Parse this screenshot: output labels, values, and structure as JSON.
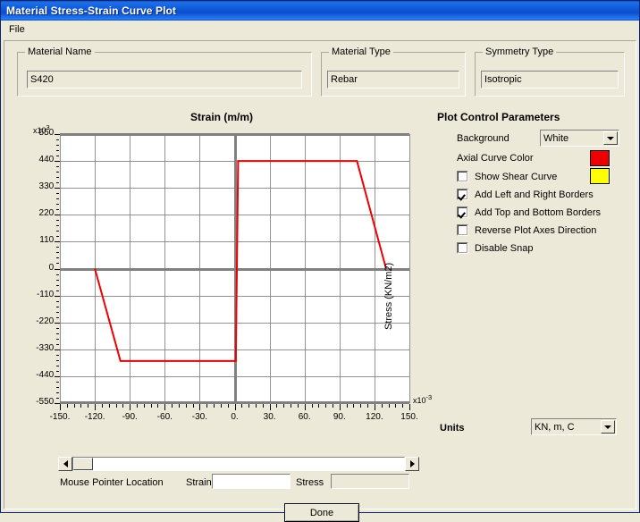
{
  "window": {
    "title": "Material Stress-Strain Curve Plot",
    "menu": [
      "File"
    ]
  },
  "material_name": {
    "caption": "Material Name",
    "value": "S420"
  },
  "material_type": {
    "caption": "Material Type",
    "value": "Rebar"
  },
  "symmetry_type": {
    "caption": "Symmetry Type",
    "value": "Isotropic"
  },
  "controls": {
    "heading": "Plot Control Parameters",
    "background_label": "Background",
    "background_value": "White",
    "axial_curve_color_label": "Axial Curve Color",
    "axial_curve_color": "#EE0000",
    "shear_curve_color": "#FFFF00",
    "checkboxes": [
      {
        "label": "Show Shear Curve",
        "checked": false
      },
      {
        "label": "Add Left and Right Borders",
        "checked": true
      },
      {
        "label": "Add Top and Bottom Borders",
        "checked": true
      },
      {
        "label": "Reverse Plot Axes Direction",
        "checked": false
      },
      {
        "label": "Disable Snap",
        "checked": false
      }
    ]
  },
  "units": {
    "label": "Units",
    "value": "KN, m, C"
  },
  "status": {
    "mouse_pointer_location": "Mouse Pointer Location",
    "strain_label": "Strain",
    "strain_value": "",
    "stress_label": "Stress",
    "stress_value": ""
  },
  "done_button": "Done",
  "chart_data": {
    "type": "line",
    "title": "Strain   (m/m)",
    "xlabel": "Strain   (m/m)",
    "ylabel": "Stress  (KN/m2)",
    "x_exponent": "x10-3",
    "y_exponent": "x103",
    "xlim": [
      -150,
      150
    ],
    "ylim": [
      -550,
      550
    ],
    "xticks": [
      -150,
      -120,
      -90,
      -60,
      -30,
      0,
      30,
      60,
      90,
      120,
      150
    ],
    "xticklabels": [
      "-150.",
      "-120.",
      "-90.",
      "-60.",
      "-30.",
      "0.",
      "30.",
      "60.",
      "90.",
      "120.",
      "150."
    ],
    "yticks": [
      550,
      440,
      330,
      220,
      110,
      0,
      -110,
      -220,
      -330,
      -440,
      -550
    ],
    "yticklabels": [
      "550.",
      "440.",
      "330.",
      "220.",
      "110.",
      "0.",
      "-110.",
      "-220.",
      "-330.",
      "-440.",
      "-550."
    ],
    "grid": true,
    "legend": false,
    "series": [
      {
        "name": "Axial Curve",
        "color": "#EE0000",
        "x": [
          -120,
          -98,
          1,
          1,
          3,
          105,
          130
        ],
        "y": [
          0,
          -378,
          -378,
          -378,
          440,
          440,
          0
        ]
      }
    ]
  }
}
